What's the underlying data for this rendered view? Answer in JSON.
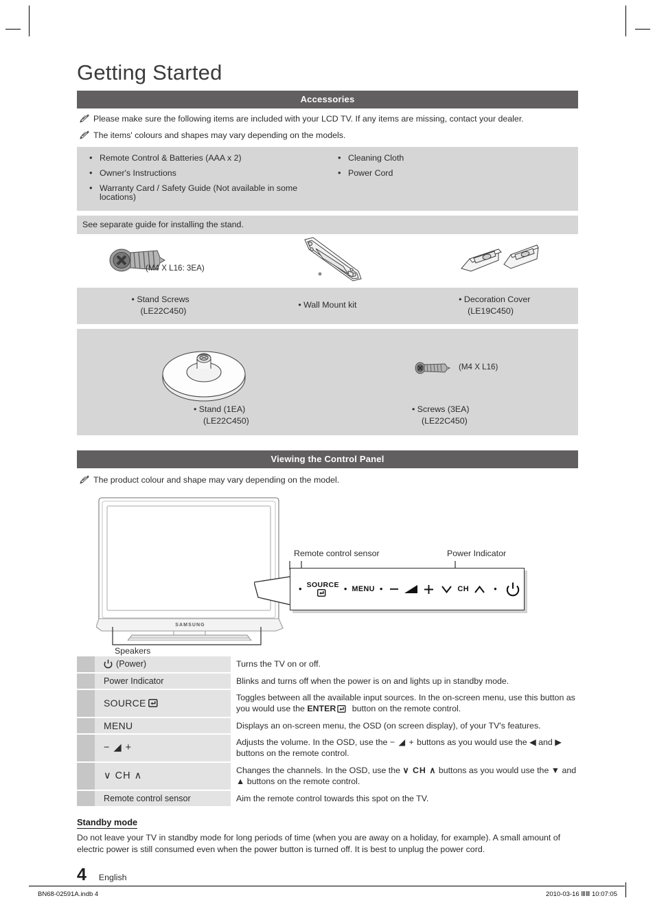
{
  "page": {
    "title": "Getting Started",
    "number": "4",
    "language": "English"
  },
  "accessories": {
    "header": "Accessories",
    "notes": [
      "Please make sure the following items are included with your LCD TV. If any items are missing, contact your dealer.",
      "The items' colours and shapes may vary depending on the models."
    ],
    "items_left": [
      "Remote Control & Batteries (AAA x 2)",
      "Owner's Instructions",
      "Warranty Card / Safety Guide (Not available in some locations)"
    ],
    "items_right": [
      "Cleaning Cloth",
      "Power Cord"
    ],
    "stand_note": "See separate guide for installing the stand.",
    "screw_spec_1": "(M4 X L16: 3EA)",
    "parts": [
      {
        "label": "Stand Screws",
        "model": "(LE22C450)"
      },
      {
        "label": "Wall Mount kit",
        "model": ""
      },
      {
        "label": "Decoration Cover",
        "model": "(LE19C450)"
      }
    ],
    "stand_block": {
      "screw_spec": "(M4 X L16)",
      "left_label": "Stand (1EA)",
      "left_model": "(LE22C450)",
      "right_label": "Screws (3EA)",
      "right_model": "(LE22C450)"
    }
  },
  "control_panel": {
    "header": "Viewing the Control Panel",
    "note": "The product colour and shape may vary depending on the model.",
    "callouts": {
      "remote_sensor": "Remote control sensor",
      "power_indicator": "Power Indicator",
      "speakers": "Speakers"
    },
    "panel_bar": {
      "source": "SOURCE",
      "menu": "MENU",
      "ch": "CH"
    },
    "brand": "SAMSUNG",
    "table": [
      {
        "label": "(Power)",
        "label_kind": "power",
        "desc": "Turns the TV on or off.",
        "two_line": false
      },
      {
        "label": "Power Indicator",
        "label_kind": "text",
        "desc": "Blinks and turns off when the power is on and lights up in standby mode.",
        "two_line": false
      },
      {
        "label": "SOURCE",
        "label_kind": "source",
        "desc_a": "Toggles between all the available input sources. In the on-screen menu, use this button as you would use the ",
        "desc_enter": "ENTER",
        "desc_b": " button on the remote control.",
        "two_line": true
      },
      {
        "label": "MENU",
        "label_kind": "menu",
        "desc": "Displays an on-screen menu, the OSD (on screen display), of your TV's features.",
        "two_line": false
      },
      {
        "label": "− ◢ +",
        "label_kind": "volume",
        "desc_a": "Adjusts the volume. In the OSD, use the ",
        "desc_mid": "− ◢ +",
        "desc_b": " buttons as you would use the ◀ and ▶ buttons on the remote control.",
        "two_line": true
      },
      {
        "label": "∨ CH ∧",
        "label_kind": "channel",
        "desc_a": "Changes the channels. In the OSD, use the ",
        "desc_mid": "∨ CH ∧",
        "desc_b": " buttons as you would use the ▼ and ▲ buttons on the remote control.",
        "two_line": true
      },
      {
        "label": "Remote control sensor",
        "label_kind": "text",
        "desc": "Aim the remote control towards this spot on the TV.",
        "two_line": false
      }
    ]
  },
  "standby": {
    "heading": "Standby mode",
    "body": "Do not leave your TV in standby mode for long periods of time (when you are away on a holiday, for example). A small amount of electric power is still consumed even when the power button is turned off. It is best to unplug the power cord."
  },
  "footer": {
    "left": "BN68-02591A.indb   4",
    "right": "2010-03-16   ⅢⅢ 10:07:05"
  },
  "colors": {
    "header_bar": "#615f5f",
    "band": "#d6d6d6",
    "table_label": "#e3e3e3",
    "table_gutter": "#c6c6c6"
  }
}
